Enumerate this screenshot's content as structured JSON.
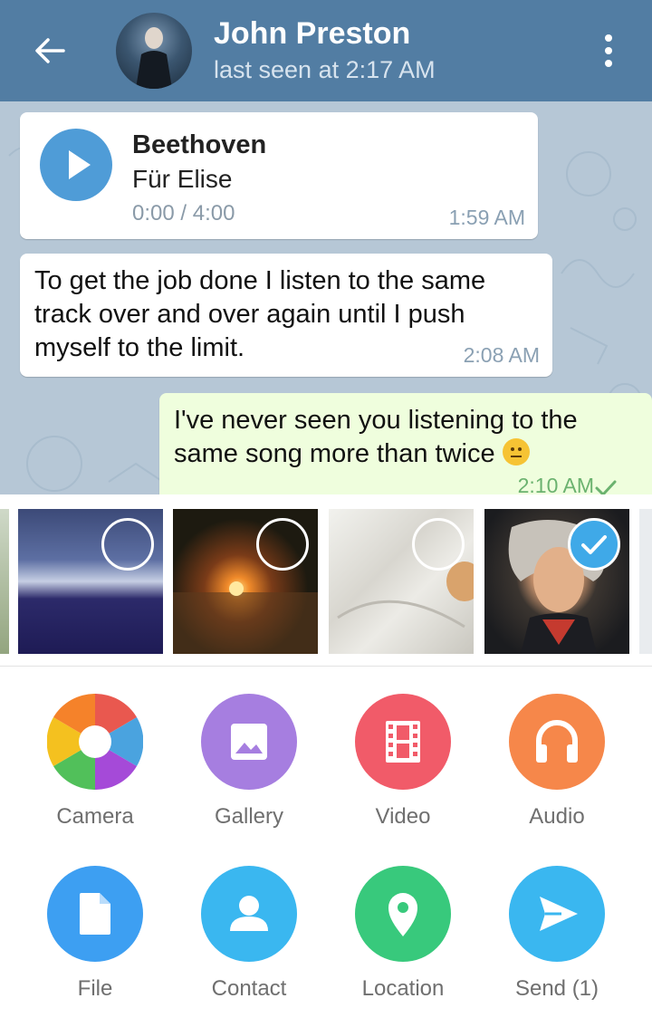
{
  "header": {
    "title": "John Preston",
    "subtitle": "last seen at 2:17 AM"
  },
  "messages": {
    "audio": {
      "artist": "Beethoven",
      "track": "Für Elise",
      "progress": "0:00 / 4:00",
      "time": "1:59 AM"
    },
    "incoming": {
      "text": "To get the job done I listen to the same track over and over again until I push myself to the limit.",
      "time": "2:08 AM"
    },
    "outgoing": {
      "text": "I've never seen you listening to the same song more than twice",
      "time": "2:10 AM"
    }
  },
  "photos": [
    {
      "selected": false
    },
    {
      "selected": false
    },
    {
      "selected": false
    },
    {
      "selected": true
    }
  ],
  "actions": [
    {
      "label": "Camera",
      "color": "#ffffff",
      "icon": "camera-icon"
    },
    {
      "label": "Gallery",
      "color": "#a67ee0",
      "icon": "gallery-icon"
    },
    {
      "label": "Video",
      "color": "#f15b69",
      "icon": "video-icon"
    },
    {
      "label": "Audio",
      "color": "#f6874a",
      "icon": "headphones-icon"
    },
    {
      "label": "File",
      "color": "#3d9ff2",
      "icon": "file-icon"
    },
    {
      "label": "Contact",
      "color": "#3ab7f0",
      "icon": "contact-icon"
    },
    {
      "label": "Location",
      "color": "#38c97c",
      "icon": "location-pin-icon"
    },
    {
      "label": "Send (1)",
      "color": "#3ab7f0",
      "icon": "send-icon"
    }
  ],
  "colors": {
    "header": "#527da3",
    "chat_bg": "#b6c7d6",
    "outgoing_bubble": "#effedd",
    "selection": "#3fa9e8"
  }
}
